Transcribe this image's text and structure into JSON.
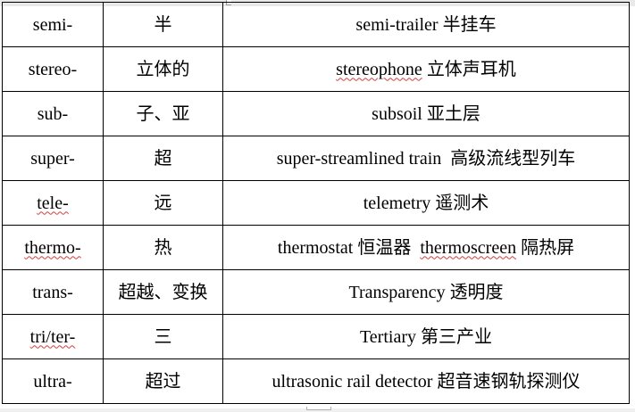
{
  "table": {
    "rows": [
      {
        "prefix": "semi-",
        "meaning": "半",
        "example": "semi-trailer 半挂车"
      },
      {
        "prefix": "stereo-",
        "meaning": "立体的",
        "example_word": "stereophone",
        "example_gloss": " 立体声耳机"
      },
      {
        "prefix": "sub-",
        "meaning": "子、亚",
        "example": "subsoil 亚土层"
      },
      {
        "prefix": "super-",
        "meaning": "超",
        "example": "super-streamlined train  高级流线型列车"
      },
      {
        "prefix": "tele-",
        "meaning": "远",
        "example": "telemetry 遥测术"
      },
      {
        "prefix": "thermo-",
        "meaning": "热",
        "example_word": "thermostat",
        "example_gloss": " 恒温器  ",
        "example_word2": "thermoscreen",
        "example_gloss2": " 隔热屏"
      },
      {
        "prefix": "trans-",
        "meaning": "超越、变换",
        "example": "Transparency 透明度"
      },
      {
        "prefix": "tri/ter-",
        "meaning": "三",
        "example": "Tertiary 第三产业"
      },
      {
        "prefix": "ultra-",
        "meaning": "超过",
        "example": "ultrasonic rail detector 超音速钢轨探测仪"
      }
    ]
  },
  "colors": {
    "text": "#000000",
    "border": "#000000",
    "spellcheck_underline": "#d43c3c",
    "page_background": "#ffffff"
  }
}
